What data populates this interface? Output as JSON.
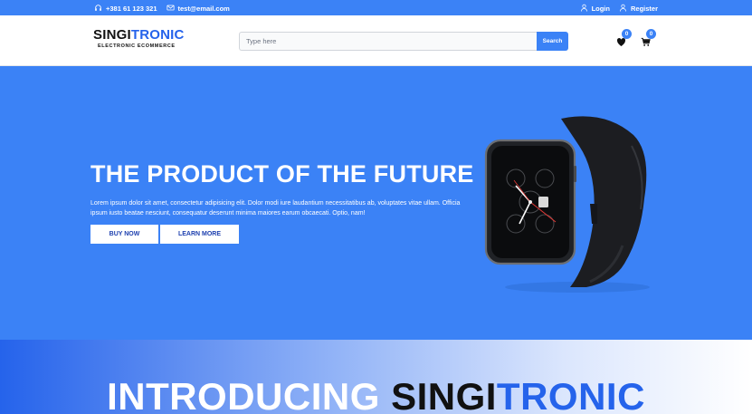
{
  "topbar": {
    "phone": "+381 61 123 321",
    "email": "test@email.com",
    "login": "Login",
    "register": "Register"
  },
  "header": {
    "logo_part1": "SINGI",
    "logo_part2": "TRONIC",
    "logo_tagline": "ELECTRONIC ECOMMERCE",
    "search_placeholder": "Type here",
    "search_button": "Search",
    "wishlist_count": "0",
    "cart_count": "0"
  },
  "hero": {
    "title": "THE PRODUCT OF THE FUTURE",
    "text": "Lorem ipsum dolor sit amet, consectetur adipisicing elit. Dolor modi iure laudantium necessitatibus ab, voluptates vitae ullam. Officia ipsum iusto beatae nesciunt, consequatur deserunt minima maiores earum obcaecati. Optio, nam!",
    "buy_button": "BUY NOW",
    "learn_button": "LEARN MORE"
  },
  "intro": {
    "word1": "INTRODUCING",
    "word2": "SINGI",
    "word3": "TRONIC"
  },
  "colors": {
    "primary": "#3b82f6",
    "dark": "#111111"
  }
}
